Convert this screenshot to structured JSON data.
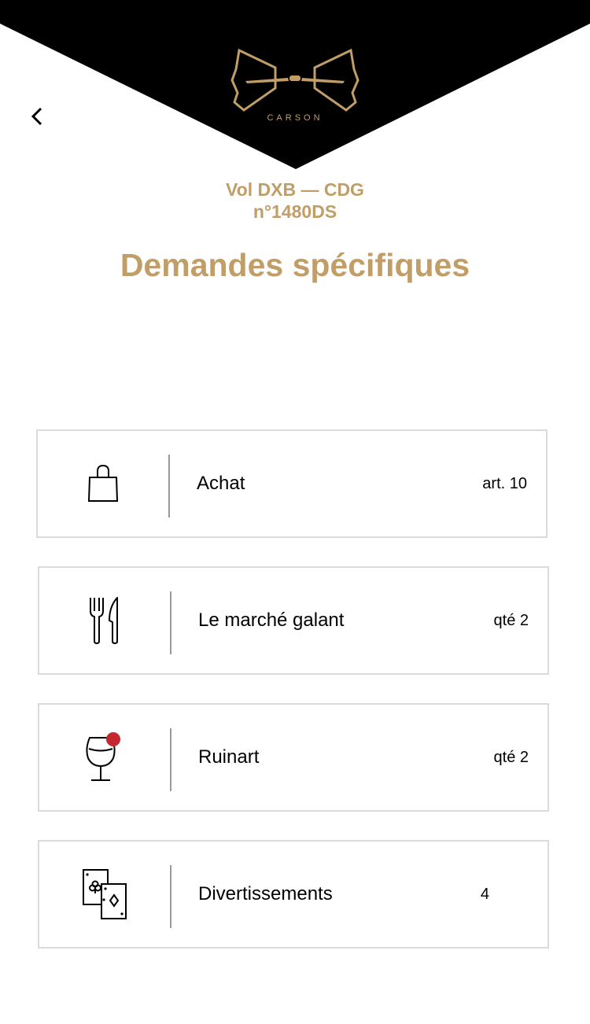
{
  "colors": {
    "accent": "#c19e67",
    "header_bg": "#000000",
    "notification_dot": "#c4272e",
    "card_border": "#dadada"
  },
  "header": {
    "brand": "CARSON",
    "back_icon": "chevron-left-icon"
  },
  "flight": {
    "route": "Vol DXB — CDG",
    "number": "n°1480DS"
  },
  "page_title": "Demandes spécifiques",
  "requests": [
    {
      "icon": "shopping-bag-icon",
      "label": "Achat",
      "count": "art. 10",
      "has_notification": false
    },
    {
      "icon": "fork-knife-icon",
      "label": "Le marché galant",
      "count": "qté 2",
      "has_notification": false
    },
    {
      "icon": "wine-glass-icon",
      "label": "Ruinart",
      "count": "qté 2",
      "has_notification": true
    },
    {
      "icon": "playing-cards-icon",
      "label": "Divertissements",
      "count": "4",
      "has_notification": false
    }
  ]
}
